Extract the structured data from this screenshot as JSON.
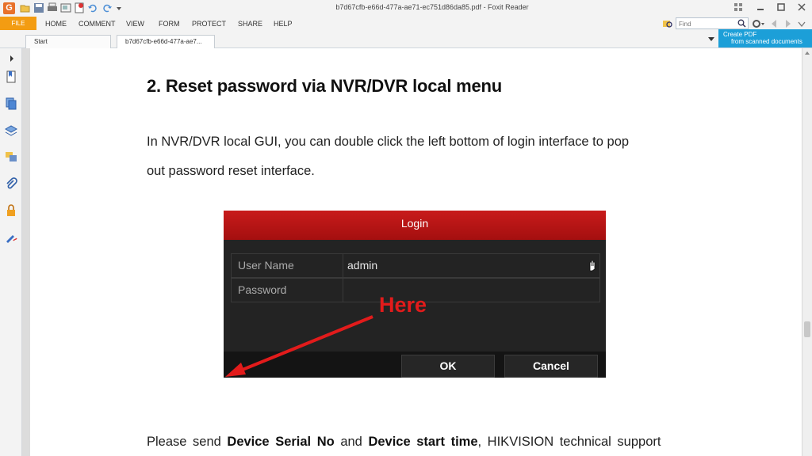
{
  "window": {
    "app_logo": "G",
    "title": "b7d67cfb-e66d-477a-ae71-ec751d86da85.pdf - Foxit Reader"
  },
  "menu": {
    "file_label": "FILE",
    "items": [
      "HOME",
      "COMMENT",
      "VIEW",
      "FORM",
      "PROTECT",
      "SHARE",
      "HELP"
    ],
    "find_placeholder": "Find"
  },
  "tabs": [
    {
      "label": "Start"
    },
    {
      "label": "b7d67cfb-e66d-477a-ae7..."
    }
  ],
  "ad": {
    "line1": "Create PDF",
    "line2": "from scanned documents"
  },
  "document": {
    "heading": "2. Reset password via NVR/DVR local menu",
    "para1": "In NVR/DVR local GUI, you can double click the left bottom of login interface to pop",
    "para2": "out password reset interface.",
    "para3_a": "Please send ",
    "para3_b": "Device Serial No",
    "para3_c": " and ",
    "para3_d": "Device start time",
    "para3_e": ", HIKVISION technical support"
  },
  "login_dialog": {
    "title": "Login",
    "user_label": "User Name",
    "user_value": "admin",
    "password_label": "Password",
    "password_value": "",
    "annotation": "Here",
    "ok_label": "OK",
    "cancel_label": "Cancel"
  },
  "icons": {
    "app": "foxit-logo-icon",
    "nav": [
      "expand-arrow-icon",
      "bookmark-icon",
      "pages-icon",
      "layers-icon",
      "comments-icon",
      "attachment-icon",
      "security-icon",
      "signature-icon"
    ]
  },
  "colors": {
    "file_tab": "#f39c12",
    "ad_banner": "#1c9fd8",
    "login_title": "#c81b1b",
    "annotation": "#e21b1b"
  }
}
